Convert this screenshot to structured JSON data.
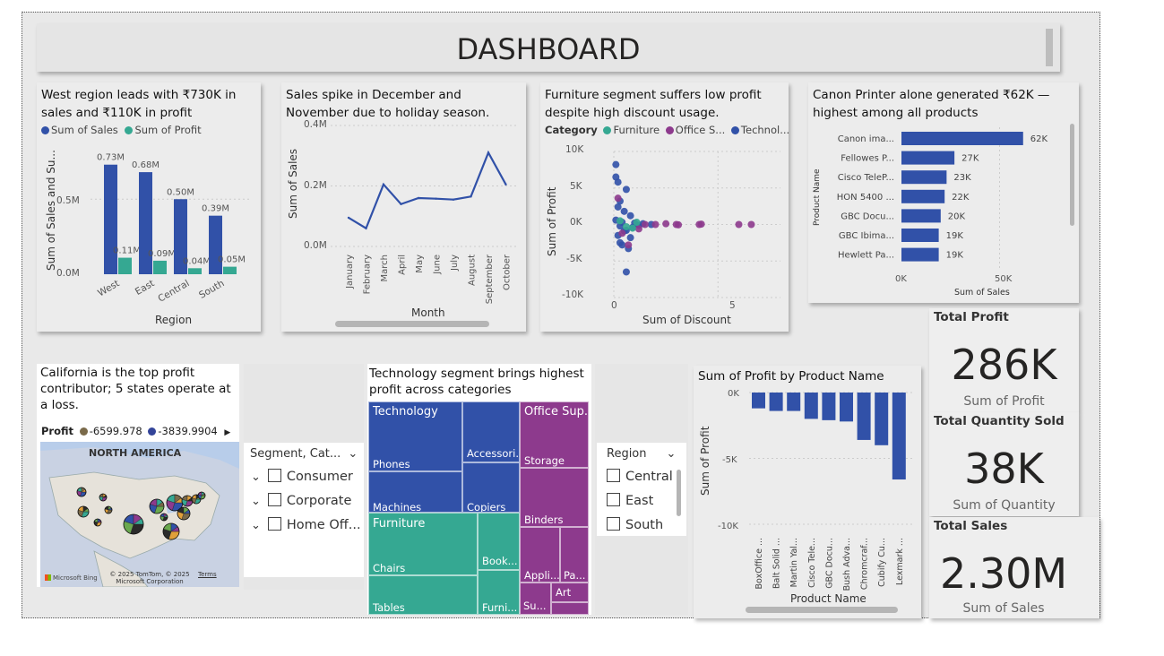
{
  "header": {
    "title": "DASHBOARD"
  },
  "region_chart": {
    "title": "West region leads with ₹730K in sales and ₹110K in profit",
    "legend": [
      "Sum of Sales",
      "Sum of Profit"
    ],
    "ylabel": "Sum of Sales and Su...",
    "xlabel": "Region",
    "yticks": [
      "0.5M",
      "0.0M"
    ]
  },
  "month_chart": {
    "title": "Sales spike in December and November due to holiday season.",
    "ylabel": "Sum of Sales",
    "xlabel": "Month",
    "yticks": [
      "0.4M",
      "0.2M",
      "0.0M"
    ]
  },
  "scatter_chart": {
    "title": "Furniture segment suffers low profit despite high discount usage.",
    "legend_title": "Category",
    "legend": [
      "Furniture",
      "Office S...",
      "Technol..."
    ],
    "ylabel": "Sum of Profit",
    "xlabel": "Sum of Discount",
    "yticks": [
      "10K",
      "5K",
      "0K",
      "-5K",
      "-10K"
    ],
    "xticks": [
      "0",
      "5"
    ]
  },
  "product_chart": {
    "title": "Canon Printer alone generated ₹62K — highest among all products",
    "ylabel": "Product Name",
    "xlabel": "Sum of Sales",
    "xticks": [
      "0K",
      "50K"
    ]
  },
  "map_visual": {
    "title": "California is the top profit contributor; 5 states operate at a loss.",
    "legend_title": "Profit",
    "legend": [
      "-6599.978",
      "-3839.9904"
    ],
    "map_label": "NORTH AMERICA",
    "bing": "Microsoft Bing",
    "copyright": "© 2025 TomTom, © 2025 Microsoft Corporation",
    "terms": "Terms"
  },
  "segment_slicer": {
    "header": "Segment, Cat...",
    "items": [
      "Consumer",
      "Corporate",
      "Home Off..."
    ]
  },
  "treemap": {
    "title": "Technology segment brings highest profit across categories",
    "labels": {
      "technology": "Technology",
      "phones": "Phones",
      "machines": "Machines",
      "accessories": "Accessori...",
      "copiers": "Copiers",
      "office": "Office Sup...",
      "storage": "Storage",
      "binders": "Binders",
      "appliances": "Appli...",
      "paper": "Pa...",
      "supplies": "Su...",
      "art": "Art",
      "furniture": "Furniture",
      "chairs": "Chairs",
      "tables": "Tables",
      "bookcases": "Book...",
      "furnishings": "Furni..."
    },
    "colors": {
      "technology": "#3151a8",
      "office": "#8d3a8d",
      "furniture": "#35a892"
    }
  },
  "region_slicer": {
    "header": "Region",
    "items": [
      "Central",
      "East",
      "South"
    ]
  },
  "loss_chart": {
    "title": "Sum of Profit by Product Name",
    "ylabel": "Sum of Profit",
    "xlabel": "Product Name",
    "yticks": [
      "0K",
      "-5K",
      "-10K"
    ]
  },
  "cards": [
    {
      "label": "Total Profit",
      "value": "286K",
      "sub": "Sum of Profit"
    },
    {
      "label": "Total Quantity Sold",
      "value": "38K",
      "sub": "Sum of Quantity"
    },
    {
      "label": "Total Sales",
      "value": "2.30M",
      "sub": "Sum of Sales"
    }
  ],
  "chart_data": [
    {
      "type": "bar",
      "title": "West region leads with ₹730K in sales and ₹110K in profit",
      "categories": [
        "West",
        "East",
        "Central",
        "South"
      ],
      "series": [
        {
          "name": "Sum of Sales",
          "values": [
            0.73,
            0.68,
            0.5,
            0.39
          ],
          "labels": [
            "0.73M",
            "0.68M",
            "0.50M",
            "0.39M"
          ],
          "color": "#3151a8"
        },
        {
          "name": "Sum of Profit",
          "values": [
            0.11,
            0.09,
            0.04,
            0.05
          ],
          "labels": [
            "0.11M",
            "0.09M",
            "0.04M",
            "0.05M"
          ],
          "color": "#35a892"
        }
      ],
      "xlabel": "Region",
      "ylabel": "Sum of Sales and Su...",
      "ylim": [
        0,
        0.8
      ]
    },
    {
      "type": "line",
      "title": "Sales spike in December and November due to holiday season.",
      "categories": [
        "January",
        "February",
        "March",
        "April",
        "May",
        "June",
        "July",
        "August",
        "September",
        "October"
      ],
      "series": [
        {
          "name": "Sum of Sales",
          "values": [
            0.095,
            0.06,
            0.205,
            0.14,
            0.16,
            0.158,
            0.155,
            0.165,
            0.31,
            0.205
          ],
          "color": "#3151a8"
        }
      ],
      "xlabel": "Month",
      "ylabel": "Sum of Sales",
      "ylim": [
        0,
        0.4
      ]
    },
    {
      "type": "scatter",
      "title": "Furniture segment suffers low profit despite high discount usage.",
      "xlabel": "Sum of Discount",
      "ylabel": "Sum of Profit",
      "xlim": [
        0,
        8
      ],
      "ylim": [
        -10000,
        10000
      ],
      "series": [
        {
          "name": "Technol...",
          "color": "#3151a8",
          "points": [
            [
              0.1,
              8200
            ],
            [
              0.1,
              6500
            ],
            [
              0.2,
              5800
            ],
            [
              0.6,
              4800
            ],
            [
              0.3,
              3200
            ],
            [
              0.2,
              2400
            ],
            [
              0.5,
              1800
            ],
            [
              0.8,
              1200
            ],
            [
              0.1,
              600
            ],
            [
              0.4,
              300
            ],
            [
              1,
              200
            ],
            [
              1.4,
              100
            ],
            [
              0.3,
              -200
            ],
            [
              0.6,
              -800
            ],
            [
              0.2,
              -1500
            ],
            [
              0.8,
              -1800
            ],
            [
              0.4,
              -2800
            ],
            [
              0.7,
              -3300
            ],
            [
              0.3,
              -2500
            ],
            [
              0.5,
              -900
            ],
            [
              0.9,
              -400
            ],
            [
              1.2,
              -100
            ],
            [
              1.8,
              0
            ],
            [
              0.6,
              -6500
            ]
          ]
        },
        {
          "name": "Office S...",
          "color": "#8d3a8d",
          "points": [
            [
              0.2,
              3600
            ],
            [
              0.4,
              -1200
            ],
            [
              0.7,
              -2800
            ],
            [
              1.2,
              -600
            ],
            [
              2,
              0
            ],
            [
              2.5,
              100
            ],
            [
              3,
              0
            ],
            [
              3.1,
              -50
            ],
            [
              4.1,
              0
            ],
            [
              4.2,
              50
            ],
            [
              6,
              0
            ],
            [
              6.6,
              0
            ],
            [
              1.5,
              0
            ]
          ]
        },
        {
          "name": "Furniture",
          "color": "#35a892",
          "points": [
            [
              0.3,
              500
            ],
            [
              0.6,
              -300
            ],
            [
              0.9,
              -500
            ],
            [
              1.1,
              300
            ]
          ]
        }
      ]
    },
    {
      "type": "bar",
      "orientation": "horizontal",
      "title": "Canon Printer alone generated ₹62K — highest among all products",
      "categories": [
        "Canon ima...",
        "Fellowes P...",
        "Cisco TeleP...",
        "HON 5400 ...",
        "GBC Docu...",
        "GBC Ibima...",
        "Hewlett Pa..."
      ],
      "series": [
        {
          "name": "Sum of Sales",
          "values": [
            62,
            27,
            23,
            22,
            20,
            19,
            19
          ],
          "labels": [
            "62K",
            "27K",
            "23K",
            "22K",
            "20K",
            "19K",
            "19K"
          ],
          "color": "#3151a8"
        }
      ],
      "xlabel": "Sum of Sales",
      "ylabel": "Product Name",
      "xlim": [
        0,
        80
      ]
    },
    {
      "type": "bar",
      "title": "Sum of Profit by Product Name",
      "categories": [
        "BoxOffice ...",
        "Balt Solid ...",
        "Martin Yal...",
        "Cisco Tele...",
        "GBC Docu...",
        "Bush Adva...",
        "Chromcraf...",
        "Cubify Cu...",
        "Lexmark ..."
      ],
      "series": [
        {
          "name": "Sum of Profit",
          "values": [
            -1.2,
            -1.4,
            -1.4,
            -2,
            -2.1,
            -2.2,
            -3.6,
            -4,
            -6.6
          ],
          "color": "#3151a8"
        }
      ],
      "xlabel": "Product Name",
      "ylabel": "Sum of Profit",
      "ylim": [
        -12,
        0
      ],
      "value_unit": "K"
    }
  ]
}
